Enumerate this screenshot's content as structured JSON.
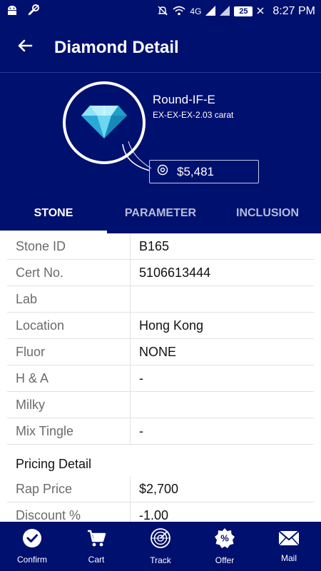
{
  "status_bar": {
    "network": "4G",
    "battery": "25",
    "time": "8:27 PM"
  },
  "header": {
    "title": "Diamond Detail"
  },
  "stone": {
    "name": "Round-IF-E",
    "subtitle": "EX-EX-EX-2.03 carat",
    "price": "$5,481"
  },
  "tabs": [
    {
      "label": "STONE",
      "active": true
    },
    {
      "label": "PARAMETER",
      "active": false
    },
    {
      "label": "INCLUSION",
      "active": false
    }
  ],
  "details": {
    "rows": [
      {
        "label": "Stone ID",
        "value": "B165"
      },
      {
        "label": "Cert No.",
        "value": "5106613444"
      },
      {
        "label": "Lab",
        "value": ""
      },
      {
        "label": "Location",
        "value": "Hong Kong"
      },
      {
        "label": "Fluor",
        "value": "NONE"
      },
      {
        "label": "H & A",
        "value": "-"
      },
      {
        "label": "Milky",
        "value": ""
      },
      {
        "label": "Mix Tingle",
        "value": "-"
      }
    ],
    "pricing_title": "Pricing Detail",
    "pricing_rows": [
      {
        "label": "Rap Price",
        "value": "$2,700"
      },
      {
        "label": "Discount %",
        "value": "-1.00"
      }
    ]
  },
  "bottom_nav": [
    {
      "label": "Confirm",
      "icon": "check-circle-icon"
    },
    {
      "label": "Cart",
      "icon": "cart-icon"
    },
    {
      "label": "Track",
      "icon": "radar-icon"
    },
    {
      "label": "Offer",
      "icon": "percent-badge-icon"
    },
    {
      "label": "Mail",
      "icon": "mail-icon"
    }
  ],
  "colors": {
    "primary": "#00106e",
    "diamond": "#3fc1e8"
  }
}
